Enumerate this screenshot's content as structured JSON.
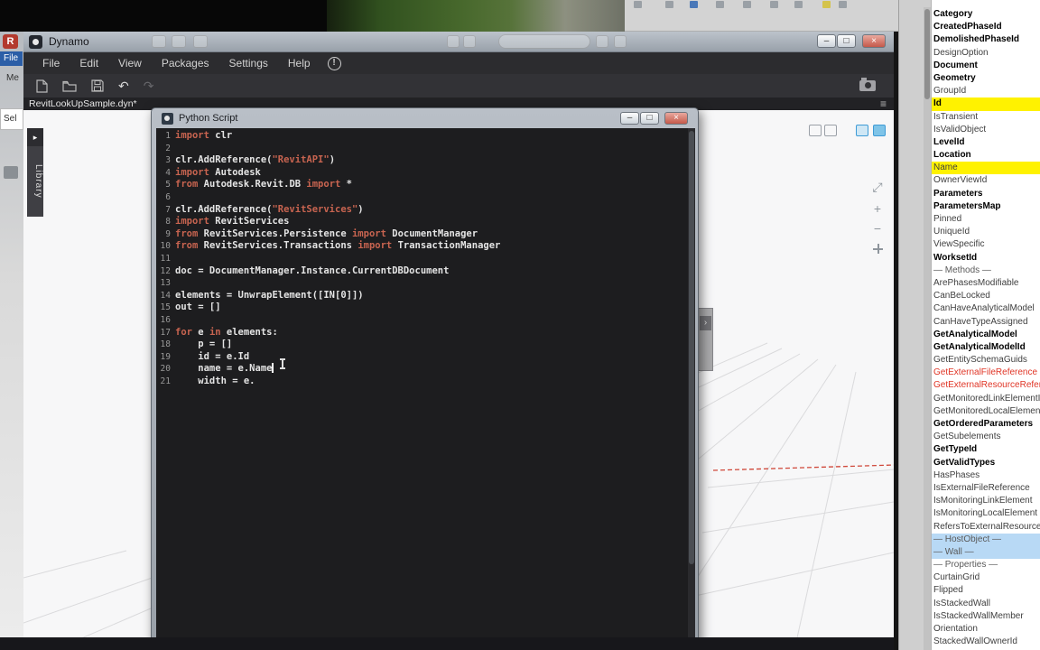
{
  "background_fragments": {
    "revit_icon_letter": "R",
    "file_tab_label": "File",
    "label_1": "Me",
    "label_2": "Sel"
  },
  "dynamo": {
    "title": "Dynamo",
    "menu": [
      "File",
      "Edit",
      "View",
      "Packages",
      "Settings",
      "Help"
    ],
    "alert_glyph": "!",
    "tab": "RevitLookUpSample.dyn*",
    "library_label": "Library",
    "library_arrow": "▸",
    "hamburger_glyph": "≡",
    "undo_glyph": "↶",
    "redo_glyph": "↷",
    "controls": {
      "minimize": "–",
      "maximize": "□",
      "close": "×"
    },
    "zoom_icons": {
      "fit": "⤢",
      "zoom_in": "+",
      "zoom_out": "−"
    },
    "node_fragment_glyph": "›"
  },
  "python_window": {
    "title": "Python Script",
    "controls": {
      "minimize": "–",
      "maximize": "□",
      "close": "×"
    },
    "colors": {
      "keyword": "#c86450",
      "string": "#c86450",
      "plain": "#e4e4e4",
      "linenum": "#989898",
      "background": "#1d1d1f"
    },
    "code": [
      {
        "n": "1",
        "s": [
          [
            "k",
            "import"
          ],
          [
            "p",
            " clr"
          ]
        ]
      },
      {
        "n": "2",
        "s": []
      },
      {
        "n": "3",
        "s": [
          [
            "p",
            "clr.AddReference("
          ],
          [
            "s",
            "\"RevitAPI\""
          ],
          [
            "p",
            ")"
          ]
        ]
      },
      {
        "n": "4",
        "s": [
          [
            "k",
            "import"
          ],
          [
            "p",
            " Autodesk"
          ]
        ]
      },
      {
        "n": "5",
        "s": [
          [
            "k",
            "from"
          ],
          [
            "p",
            " Autodesk.Revit.DB "
          ],
          [
            "k",
            "import"
          ],
          [
            "p",
            " *"
          ]
        ]
      },
      {
        "n": "6",
        "s": []
      },
      {
        "n": "7",
        "s": [
          [
            "p",
            "clr.AddReference("
          ],
          [
            "s",
            "\"RevitServices\""
          ],
          [
            "p",
            ")"
          ]
        ]
      },
      {
        "n": "8",
        "s": [
          [
            "k",
            "import"
          ],
          [
            "p",
            " RevitServices"
          ]
        ]
      },
      {
        "n": "9",
        "s": [
          [
            "k",
            "from"
          ],
          [
            "p",
            " RevitServices.Persistence "
          ],
          [
            "k",
            "import"
          ],
          [
            "p",
            " DocumentManager"
          ]
        ]
      },
      {
        "n": "10",
        "s": [
          [
            "k",
            "from"
          ],
          [
            "p",
            " RevitServices.Transactions "
          ],
          [
            "k",
            "import"
          ],
          [
            "p",
            " TransactionManager"
          ]
        ]
      },
      {
        "n": "11",
        "s": []
      },
      {
        "n": "12",
        "s": [
          [
            "p",
            "doc = DocumentManager.Instance.CurrentDBDocument"
          ]
        ]
      },
      {
        "n": "13",
        "s": []
      },
      {
        "n": "14",
        "s": [
          [
            "p",
            "elements = UnwrapElement([IN[0]])"
          ]
        ]
      },
      {
        "n": "15",
        "s": [
          [
            "p",
            "out = []"
          ]
        ]
      },
      {
        "n": "16",
        "s": []
      },
      {
        "n": "17",
        "s": [
          [
            "k",
            "for"
          ],
          [
            "p",
            " e "
          ],
          [
            "k",
            "in"
          ],
          [
            "p",
            " elements:"
          ]
        ]
      },
      {
        "n": "18",
        "s": [
          [
            "p",
            "    p = []"
          ]
        ]
      },
      {
        "n": "19",
        "s": [
          [
            "p",
            "    id = e.Id"
          ]
        ]
      },
      {
        "n": "20",
        "s": [
          [
            "p",
            "    name = e.Name"
          ]
        ],
        "caret": true
      },
      {
        "n": "21",
        "s": [
          [
            "p",
            "    width = e."
          ]
        ]
      }
    ]
  },
  "lookup": {
    "colors": {
      "y": "#fff200",
      "bl": "#b8d9f5",
      "red": "#e03526"
    },
    "members": [
      {
        "t": "Category",
        "s": "b"
      },
      {
        "t": "CreatedPhaseId",
        "s": "b"
      },
      {
        "t": "DemolishedPhaseId",
        "s": "b"
      },
      {
        "t": "DesignOption",
        "s": "n"
      },
      {
        "t": "Document",
        "s": "b"
      },
      {
        "t": "Geometry",
        "s": "b"
      },
      {
        "t": "GroupId",
        "s": "n"
      },
      {
        "t": "Id",
        "s": "b",
        "h": "y"
      },
      {
        "t": "IsTransient",
        "s": "n"
      },
      {
        "t": "IsValidObject",
        "s": "n"
      },
      {
        "t": "LevelId",
        "s": "b"
      },
      {
        "t": "Location",
        "s": "b"
      },
      {
        "t": "Name",
        "s": "n",
        "h": "y"
      },
      {
        "t": "OwnerViewId",
        "s": "n"
      },
      {
        "t": "Parameters",
        "s": "b"
      },
      {
        "t": "ParametersMap",
        "s": "b"
      },
      {
        "t": "Pinned",
        "s": "n"
      },
      {
        "t": "UniqueId",
        "s": "n"
      },
      {
        "t": "ViewSpecific",
        "s": "n"
      },
      {
        "t": "WorksetId",
        "s": "b"
      },
      {
        "t": "— Methods —",
        "s": "d"
      },
      {
        "t": "ArePhasesModifiable",
        "s": "n"
      },
      {
        "t": "CanBeLocked",
        "s": "n"
      },
      {
        "t": "CanHaveAnalyticalModel",
        "s": "n"
      },
      {
        "t": "CanHaveTypeAssigned",
        "s": "n"
      },
      {
        "t": "GetAnalyticalModel",
        "s": "b"
      },
      {
        "t": "GetAnalyticalModelId",
        "s": "b"
      },
      {
        "t": "GetEntitySchemaGuids",
        "s": "n"
      },
      {
        "t": "GetExternalFileReference",
        "s": "r"
      },
      {
        "t": "GetExternalResourceReferences",
        "s": "r"
      },
      {
        "t": "GetMonitoredLinkElementIds",
        "s": "n"
      },
      {
        "t": "GetMonitoredLocalElementIds",
        "s": "n"
      },
      {
        "t": "GetOrderedParameters",
        "s": "b"
      },
      {
        "t": "GetSubelements",
        "s": "n"
      },
      {
        "t": "GetTypeId",
        "s": "b"
      },
      {
        "t": "GetValidTypes",
        "s": "b"
      },
      {
        "t": "HasPhases",
        "s": "n"
      },
      {
        "t": "IsExternalFileReference",
        "s": "n"
      },
      {
        "t": "IsMonitoringLinkElement",
        "s": "n"
      },
      {
        "t": "IsMonitoringLocalElement",
        "s": "n"
      },
      {
        "t": "RefersToExternalResourceReferences",
        "s": "n"
      },
      {
        "t": "— HostObject —",
        "s": "d",
        "h": "bl"
      },
      {
        "t": "— Wall —",
        "s": "d",
        "h": "bl"
      },
      {
        "t": "— Properties —",
        "s": "d"
      },
      {
        "t": "CurtainGrid",
        "s": "n"
      },
      {
        "t": "Flipped",
        "s": "n"
      },
      {
        "t": "IsStackedWall",
        "s": "n"
      },
      {
        "t": "IsStackedWallMember",
        "s": "n"
      },
      {
        "t": "Orientation",
        "s": "n"
      },
      {
        "t": "StackedWallOwnerId",
        "s": "n"
      }
    ]
  }
}
